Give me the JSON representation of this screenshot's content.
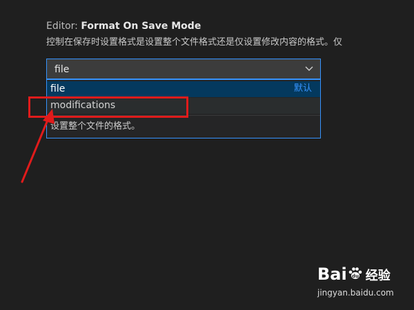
{
  "setting": {
    "category": "Editor: ",
    "name": "Format On Save Mode",
    "description": "控制在保存时设置格式是设置整个文件格式还是仅设置修改内容的格式。仅"
  },
  "select": {
    "value": "file",
    "chevron_icon": "chevron-down-icon"
  },
  "dropdown": {
    "options": [
      {
        "label": "file",
        "tag": "默认",
        "selected": true
      },
      {
        "label": "modifications",
        "tag": "",
        "selected": false
      }
    ],
    "option_description": "设置整个文件的格式。"
  },
  "annotation": {
    "color": "#e01b1b"
  },
  "watermark": {
    "brand_text": "Bai du 经验",
    "url": "jingyan.baidu.com"
  },
  "colors": {
    "background": "#1f1f1f",
    "accent": "#3794ff",
    "selected_option": "#04395e"
  }
}
